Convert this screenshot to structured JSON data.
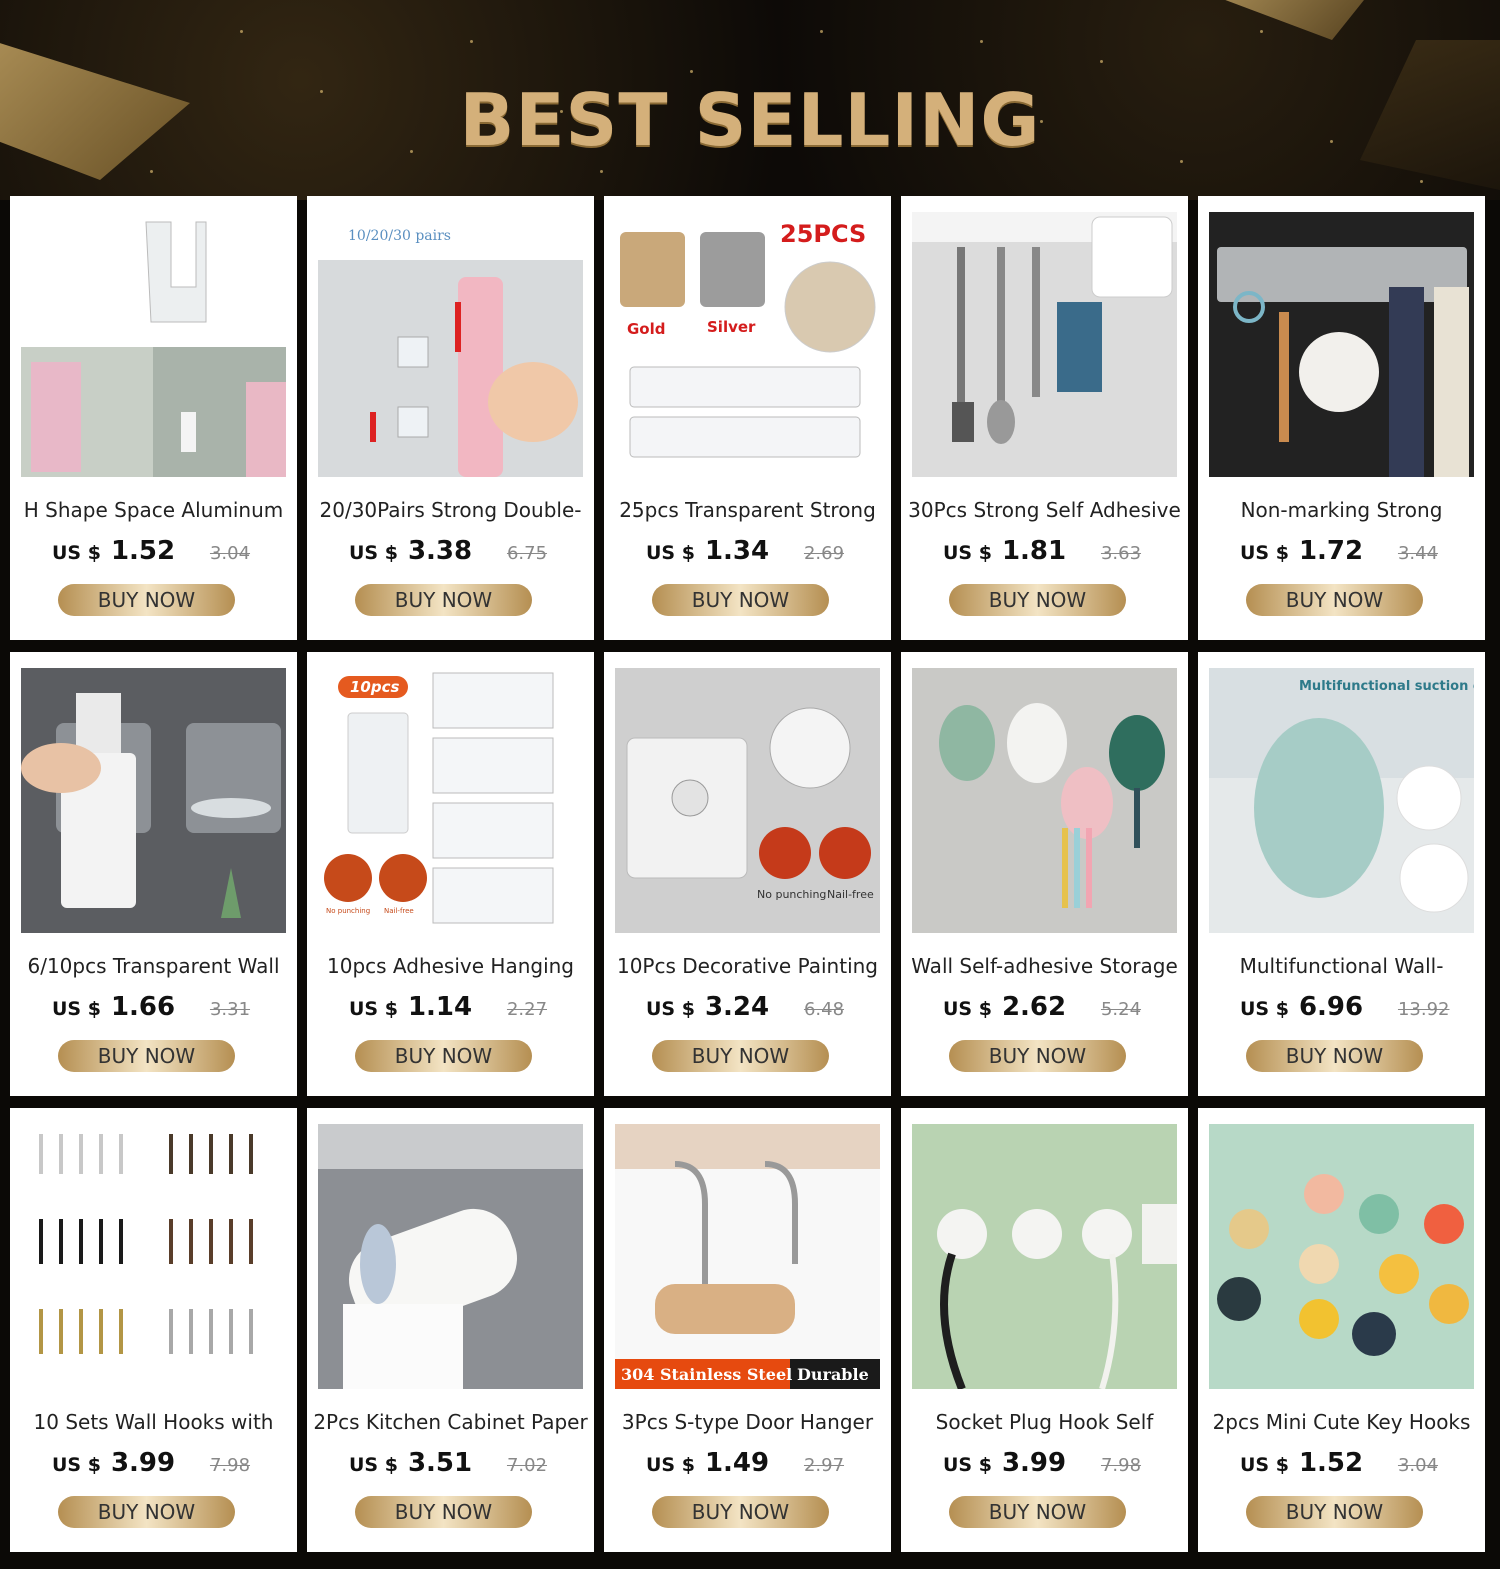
{
  "header": {
    "title": "BEST SELLING"
  },
  "buy_label": "BUY NOW",
  "currency": "US $",
  "products": [
    {
      "name": "H Shape Space Aluminum",
      "price": "1.52",
      "old_price": "3.04",
      "icon": "h-hook-image"
    },
    {
      "name": "20/30Pairs Strong Double-",
      "price": "3.38",
      "old_price": "6.75",
      "icon": "power-strip-holder-image"
    },
    {
      "name": "25pcs Transparent Strong",
      "price": "1.34",
      "old_price": "2.69",
      "icon": "adhesive-hooks-25pcs-image"
    },
    {
      "name": "30Pcs Strong Self Adhesive",
      "price": "1.81",
      "old_price": "3.63",
      "icon": "kitchen-utensil-hooks-image"
    },
    {
      "name": "Non-marking Strong",
      "price": "1.72",
      "old_price": "3.44",
      "icon": "hook-rail-image"
    },
    {
      "name": "6/10pcs Transparent Wall",
      "price": "1.66",
      "old_price": "3.31",
      "icon": "soap-bottle-holder-image"
    },
    {
      "name": "10pcs Adhesive Hanging",
      "price": "1.14",
      "old_price": "2.27",
      "icon": "adhesive-hanging-hooks-image"
    },
    {
      "name": "10Pcs Decorative Painting",
      "price": "3.24",
      "old_price": "6.48",
      "icon": "painting-hook-image"
    },
    {
      "name": "Wall Self-adhesive Storage",
      "price": "2.62",
      "old_price": "5.24",
      "icon": "cactus-toothbrush-holder-image"
    },
    {
      "name": "Multifunctional Wall-",
      "price": "6.96",
      "old_price": "13.92",
      "icon": "cactus-suction-cup-rack-image"
    },
    {
      "name": "10 Sets Wall Hooks with",
      "price": "3.99",
      "old_price": "7.98",
      "icon": "wall-hooks-set-image"
    },
    {
      "name": "2Pcs Kitchen Cabinet Paper",
      "price": "3.51",
      "old_price": "7.02",
      "icon": "paper-towel-holder-image"
    },
    {
      "name": "3Pcs S-type Door Hanger",
      "price": "1.49",
      "old_price": "2.97",
      "icon": "s-type-door-hanger-image"
    },
    {
      "name": "Socket Plug Hook  Self",
      "price": "3.99",
      "old_price": "7.98",
      "icon": "astronaut-plug-hook-image"
    },
    {
      "name": "2pcs Mini Cute Key Hooks",
      "price": "1.52",
      "old_price": "3.04",
      "icon": "cute-key-hooks-image"
    }
  ],
  "image_text": {
    "p2_badge": "10/20/30 pairs",
    "p3_badge": "25PCS",
    "p3_gold": "Gold",
    "p3_silver": "Silver",
    "p7_badge": "10pcs",
    "p7_no_punching": "No punching",
    "p7_nail_free": "Nail-free",
    "p8_no_punching": "No punching",
    "p8_nail_free": "Nail-free",
    "p10_caption": "Multifunctional suction cup storage rack",
    "p13_steel": "304 Stainless Steel",
    "p13_durable": "Durable"
  }
}
